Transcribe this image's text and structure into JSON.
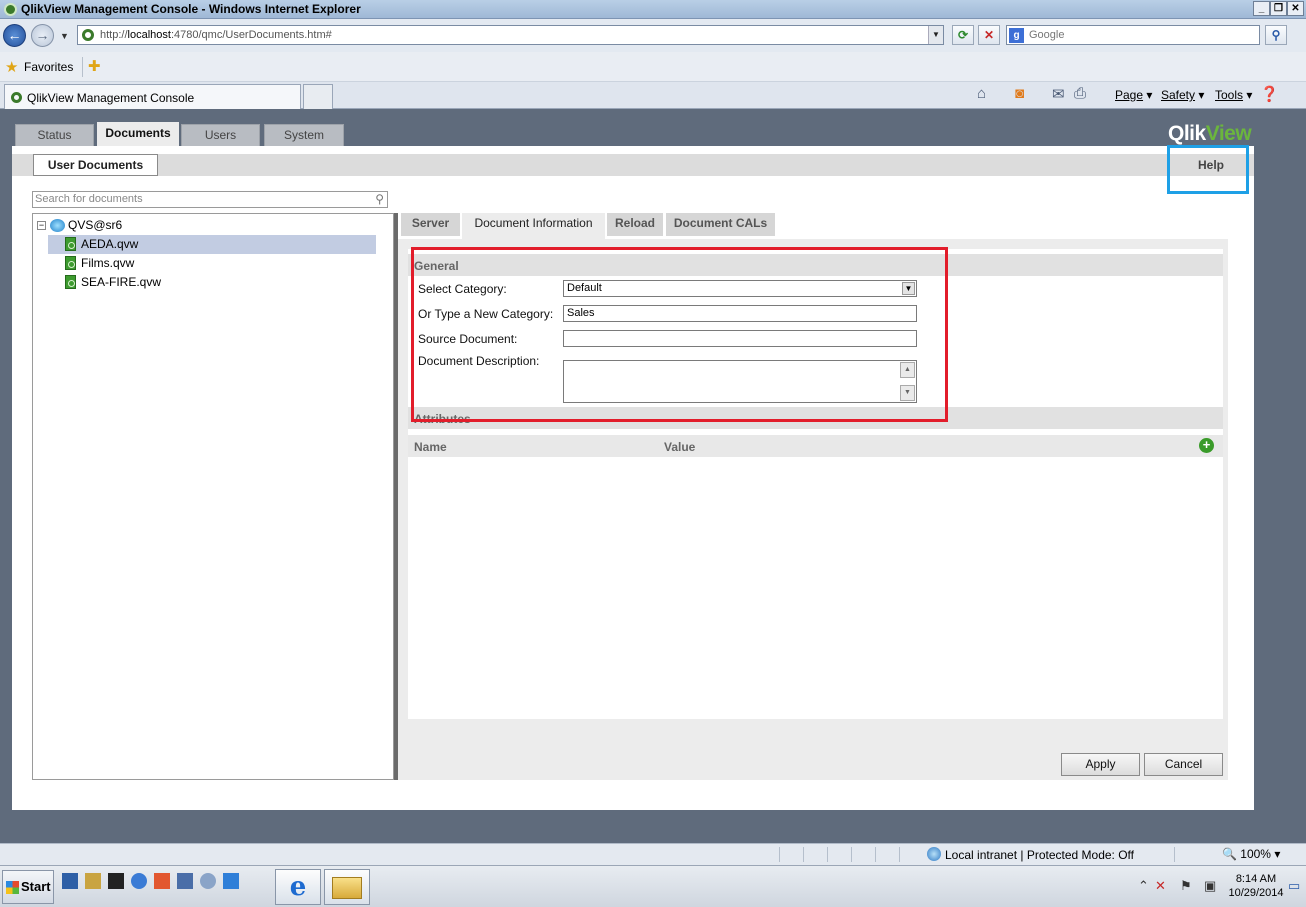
{
  "window": {
    "title": "QlikView Management Console - Windows Internet Explorer",
    "minimize": "_",
    "restore": "❐",
    "close": "✕"
  },
  "browser": {
    "url_prefix": "http://",
    "url_host": "localhost",
    "url_rest": ":4780/qmc/UserDocuments.htm#",
    "search_placeholder": "Google",
    "favorites_label": "Favorites",
    "tab_title": "QlikView Management Console",
    "commands": {
      "page": "Page",
      "safety": "Safety",
      "tools": "Tools"
    }
  },
  "app": {
    "logo_qlik": "Qlik",
    "logo_view": "View",
    "main_tabs": [
      "Status",
      "Documents",
      "Users",
      "System"
    ],
    "active_main_tab": "Documents",
    "sub_tab": "User Documents",
    "help_label": "Help",
    "search_placeholder": "Search for documents",
    "tree": {
      "server": "QVS@sr6",
      "documents": [
        "AEDA.qvw",
        "Films.qvw",
        "SEA-FIRE.qvw"
      ],
      "selected": "AEDA.qvw"
    },
    "detail_tabs": [
      "Server",
      "Document Information",
      "Reload",
      "Document CALs"
    ],
    "active_detail_tab": "Document Information",
    "general": {
      "section_label": "General",
      "select_category_label": "Select Category:",
      "select_category_value": "Default",
      "new_category_label": "Or Type a New Category:",
      "new_category_value": "Sales",
      "source_document_label": "Source Document:",
      "source_document_value": "",
      "description_label": "Document Description:",
      "description_value": ""
    },
    "attributes": {
      "section_label": "Attributes",
      "col_name": "Name",
      "col_value": "Value"
    },
    "apply_label": "Apply",
    "cancel_label": "Cancel"
  },
  "statusbar": {
    "zone_text": "Local intranet | Protected Mode: Off",
    "zoom": "100%"
  },
  "taskbar": {
    "start_label": "Start",
    "time": "8:14 AM",
    "date": "10/29/2014"
  },
  "colors": {
    "highlight_red": "#e21d2b",
    "highlight_blue": "#1ea0e6",
    "qlik_green": "#6bb63d"
  }
}
